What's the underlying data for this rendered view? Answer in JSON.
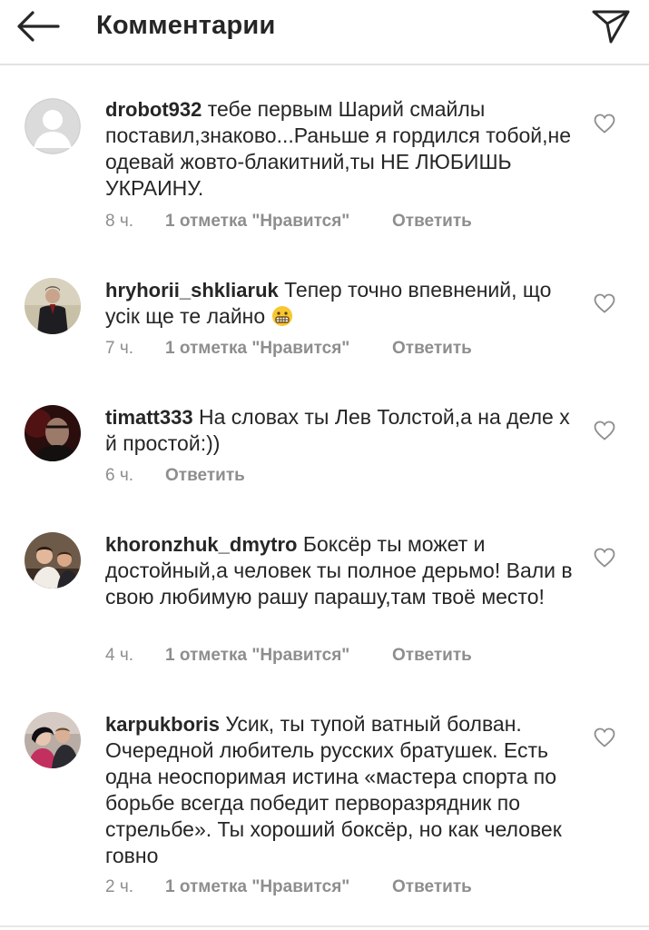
{
  "header": {
    "back_icon": "arrow-left-icon",
    "title": "Комментарии",
    "share_icon": "paper-plane-icon"
  },
  "comments": [
    {
      "username": "drobot932",
      "text": "тебе первым Шарий смайлы поставил,знаково...Раньше я гордился тобой,не одевай жовто-блакитний,ты  НЕ ЛЮБИШЬ УКРАИНУ.",
      "time": "8 ч.",
      "likes": "1 отметка \"Нравится\"",
      "reply": "Ответить",
      "avatar": "default-avatar"
    },
    {
      "username": "hryhorii_shkliaruk",
      "text": "Тепер точно впевнений, що усік ще те лайно",
      "emoji": "grimacing-face-emoji",
      "time": "7 ч.",
      "likes": "1 отметка \"Нравится\"",
      "reply": "Ответить",
      "avatar": "user-photo"
    },
    {
      "username": "timatt333",
      "text": "На словах ты Лев Толстой,а на деле х  й простой:))",
      "time": "6 ч.",
      "reply": "Ответить",
      "avatar": "user-photo"
    },
    {
      "username": "khoronzhuk_dmytro",
      "text": "Боксёр ты может и достойный,а человек ты полное дерьмо! Вали в свою любимую рашу парашу,там твоё место!",
      "time": "4 ч.",
      "likes": "1 отметка \"Нравится\"",
      "reply": "Ответить",
      "avatar": "user-photo"
    },
    {
      "username": "karpukboris",
      "text": "Усик, ты тупой ватный болван. Очередной любитель русских братушек. Есть одна неоспоримая истина «мастера спорта по борьбе всегда победит перворазрядник по стрельбе». Ты хороший боксёр, но как человек говно",
      "time": "2 ч.",
      "likes": "1 отметка \"Нравится\"",
      "reply": "Ответить",
      "avatar": "user-photo"
    }
  ],
  "colors": {
    "text": "#262626",
    "secondary": "#8e8e8e",
    "divider": "#e3e3e3"
  }
}
